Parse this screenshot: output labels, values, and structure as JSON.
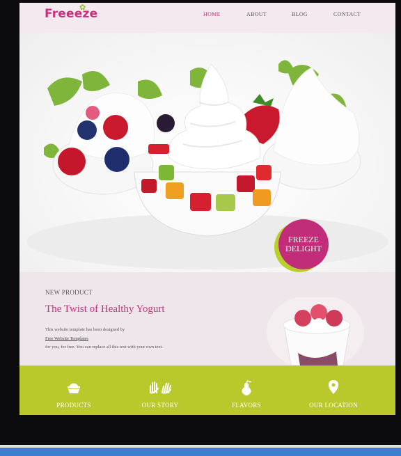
{
  "header": {
    "logo_text": "Freeeze",
    "nav": [
      "HOME",
      "ABOUT",
      "BLOG",
      "CONTACT"
    ]
  },
  "hero": {
    "badge_line1": "FREEZE",
    "badge_line2": "DELIGHT"
  },
  "new_product": {
    "label": "NEW PRODUCT",
    "title": "The Twist of Healthy Yogurt",
    "text_line1": "This website template has been designed by",
    "link_text": "Free Website Templates",
    "text_line3": "for you, for free. You can replace all this text with your own text."
  },
  "feature_bar": {
    "items": [
      {
        "label": "PRODUCTS",
        "icon": "cupcake-icon"
      },
      {
        "label": "OUR STORY",
        "icon": "hands-icon"
      },
      {
        "label": "FLAVORS",
        "icon": "pear-icon"
      },
      {
        "label": "OUR LOCATION",
        "icon": "location-pin-icon"
      }
    ]
  },
  "colors": {
    "brand": "#c8317c",
    "accent_green": "#b9c92b",
    "header_bg": "#f3e9ee",
    "band_bg": "#eee6ea"
  }
}
